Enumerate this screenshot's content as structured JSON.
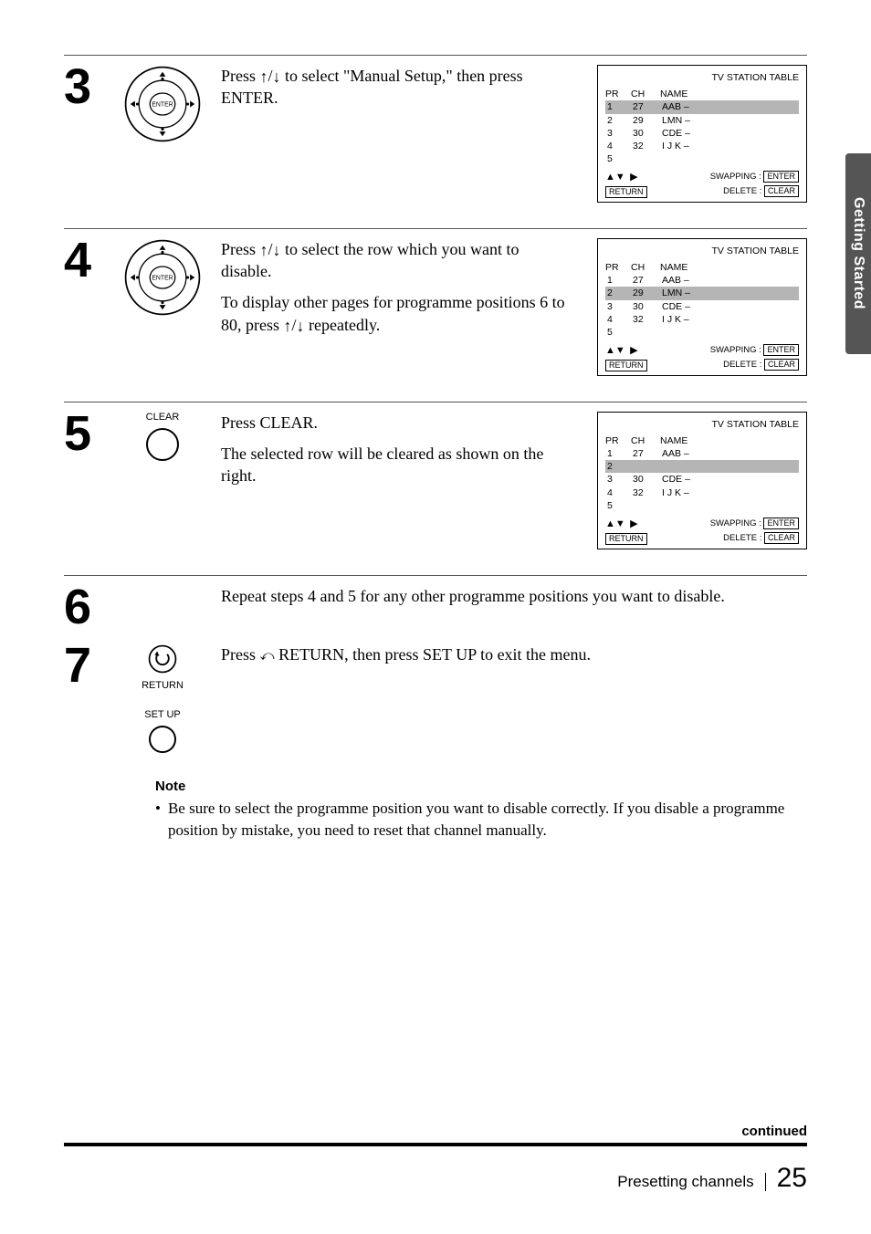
{
  "sideTab": "Getting Started",
  "steps": {
    "s3": {
      "num": "3",
      "text1": "Press ↑/↓ to select \"Manual Setup,\" then press ENTER."
    },
    "s4": {
      "num": "4",
      "text1": "Press ↑/↓ to select the row which you want to disable.",
      "text2": "To display other pages for programme positions 6 to 80, press ↑/↓ repeatedly."
    },
    "s5": {
      "num": "5",
      "iconLabel": "CLEAR",
      "text1": "Press CLEAR.",
      "text2": "The selected row will be cleared as shown on the right."
    },
    "s6": {
      "num": "6",
      "text1": "Repeat steps 4 and 5 for any other programme positions you want to disable."
    },
    "s7": {
      "num": "7",
      "iconLabel1": "RETURN",
      "iconLabel2": "SET UP",
      "text1": "Press ⟳ RETURN, then press SET UP to exit the menu."
    }
  },
  "osd": {
    "title": "TV STATION TABLE",
    "hdr": {
      "pr": "PR",
      "ch": "CH",
      "name": "NAME"
    },
    "t3": [
      {
        "pr": "1",
        "ch": "27",
        "name": "AAB –",
        "hl": true
      },
      {
        "pr": "2",
        "ch": "29",
        "name": "LMN –"
      },
      {
        "pr": "3",
        "ch": "30",
        "name": "CDE –"
      },
      {
        "pr": "4",
        "ch": "32",
        "name": "I J K –"
      },
      {
        "pr": "5",
        "ch": "",
        "name": ""
      }
    ],
    "t4": [
      {
        "pr": "1",
        "ch": "27",
        "name": "AAB –"
      },
      {
        "pr": "2",
        "ch": "29",
        "name": "LMN –",
        "hl": true
      },
      {
        "pr": "3",
        "ch": "30",
        "name": "CDE –"
      },
      {
        "pr": "4",
        "ch": "32",
        "name": "I J K –"
      },
      {
        "pr": "5",
        "ch": "",
        "name": ""
      }
    ],
    "t5": [
      {
        "pr": "1",
        "ch": "27",
        "name": "AAB –"
      },
      {
        "pr": "2",
        "ch": "",
        "name": "",
        "hl": true
      },
      {
        "pr": "3",
        "ch": "30",
        "name": "CDE –"
      },
      {
        "pr": "4",
        "ch": "32",
        "name": "I J K –"
      },
      {
        "pr": "5",
        "ch": "",
        "name": ""
      }
    ],
    "footArrows1": "▲▼",
    "footArrows2": "▶",
    "footReturn": "RETURN",
    "swapping": "SWAPPING :",
    "enter": "ENTER",
    "delete": "DELETE :",
    "clear": "CLEAR"
  },
  "note": {
    "title": "Note",
    "text": "Be sure to select the programme position you want to disable correctly.  If you disable a programme position by mistake, you need to reset that channel manually."
  },
  "footer": {
    "continued": "continued",
    "label": "Presetting channels",
    "page": "25"
  }
}
